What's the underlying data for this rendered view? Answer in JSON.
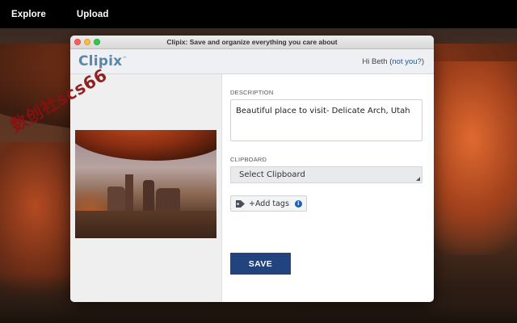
{
  "topnav": {
    "items": [
      {
        "label": "Explore"
      },
      {
        "label": "Upload"
      }
    ]
  },
  "window": {
    "title": "Clipix: Save and organize everything you care about"
  },
  "header": {
    "logo": "Clipix",
    "greeting": "Hi Beth",
    "not_you_open": "(",
    "not_you_link": "not you?",
    "not_you_close": ")"
  },
  "form": {
    "description_label": "DESCRIPTION",
    "description_value": "Beautiful place to visit- Delicate Arch, Utah",
    "clipboard_label": "CLIPBOARD",
    "clipboard_selected": "Select Clipboard",
    "add_tags_label": "+Add tags",
    "save_label": "SAVE"
  },
  "watermark": {
    "text": "数创社scs66"
  },
  "icons": {
    "tag": "tag-icon",
    "info": "info-icon",
    "caret": "caret-down-icon"
  },
  "colors": {
    "save_button": "#23437f",
    "logo": "#5a86a8",
    "link": "#23558f",
    "info": "#2060b8"
  }
}
